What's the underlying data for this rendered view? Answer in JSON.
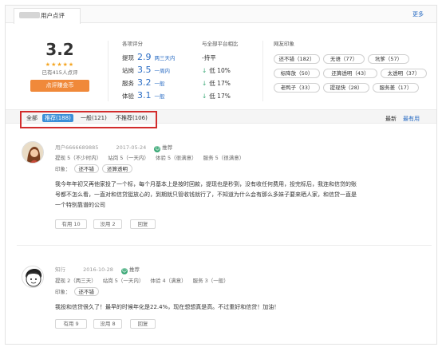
{
  "header": {
    "tab_label": "用户点评",
    "more": "更多"
  },
  "summary": {
    "score": "3.2",
    "stars": "★★★★★",
    "count_text": "已有415人点评",
    "button": "点评赚金币"
  },
  "metrics": {
    "title": "各项评分",
    "items": [
      {
        "label": "提现",
        "value": "2.9",
        "desc": "两三天内"
      },
      {
        "label": "站岗",
        "value": "3.5",
        "desc": "一周内"
      },
      {
        "label": "服务",
        "value": "3.2",
        "desc": "一般"
      },
      {
        "label": "体验",
        "value": "3.1",
        "desc": "一般"
      }
    ]
  },
  "compare": {
    "title": "与全部平台相比",
    "items": [
      "-持平",
      "低 10%",
      "低 17%",
      "低 17%"
    ],
    "arrow_color": "#3aa876"
  },
  "impressions": {
    "title": "网友印象",
    "tags": [
      "还不错（182）",
      "无语（77）",
      "坑爹（57）",
      "标降放（50）",
      "还算透明（43）",
      "太透明（37）",
      "老鸭子（33）",
      "提现快（28）",
      "服务差（17）"
    ]
  },
  "filter": {
    "all": "全部",
    "recommend": "推荐(188)",
    "normal": "一般(121)",
    "not_recommend": "不推荐(106)",
    "sort_latest": "最新",
    "sort_useful": "最有用",
    "highlight_color": "#d22c2c"
  },
  "reviews": [
    {
      "name": "用户6666689885",
      "date": "2017-05-24",
      "recommend": "推荐",
      "scores": [
        "提现 5（不少时内）",
        "站岗 5（一天内）",
        "体验 5（很满意）",
        "服务 5（很满意）"
      ],
      "impress_label": "印象：",
      "tags": [
        "还不错",
        "还算透明"
      ],
      "text_lines": [
        "我今年年初又再他家投了一个标，每个月基本上是按时回款，提现也是秒到，没有收任何费用，投完标后，我连和信贷的账",
        "号都不怎么看，一直对和信贷挺放心的，到期就只管收钱就行了，不知道为什么会有那么多妹子要来晒人家，和信贷一直是",
        "一个特别靠谱的公司"
      ],
      "actions": [
        "有用 10",
        "没用 2",
        "回复"
      ]
    },
    {
      "name": "知行",
      "date": "2016-10-28",
      "recommend": "推荐",
      "scores": [
        "提现 2（两三天）",
        "站岗 5（一天内）",
        "体验 4（满意）",
        "服务 3（一般）"
      ],
      "impress_label": "印象：",
      "tags": [
        "还不错"
      ],
      "text_lines": [
        "我投和信贷很久了！最早的时候年化是22.4%，现在想想真是高。不过重好和信贷！加油！"
      ],
      "actions": [
        "有用 9",
        "没用 8",
        "回复"
      ]
    }
  ]
}
